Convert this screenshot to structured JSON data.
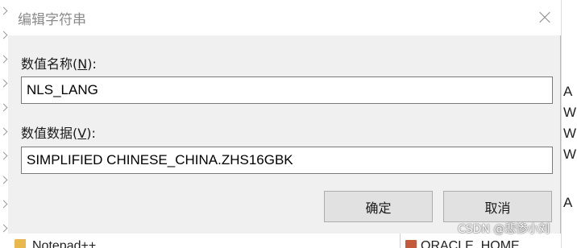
{
  "dialog": {
    "title": "编辑字符串",
    "close_icon": "close-icon",
    "value_name_label_prefix": "数值名称(",
    "value_name_label_key": "N",
    "value_name_label_suffix": "):",
    "value_name": "NLS_LANG",
    "value_data_label_prefix": "数值数据(",
    "value_data_label_key": "V",
    "value_data_label_suffix": "):",
    "value_data": "SIMPLIFIED CHINESE_CHINA.ZHS16GBK",
    "ok_label": "确定",
    "cancel_label": "取消"
  },
  "background": {
    "right_truncated": [
      "A",
      "W",
      "W",
      "W",
      "A"
    ],
    "bottom_left_item": "Notepad++",
    "bottom_right_item": "ORACLE_HOME"
  },
  "watermark": "CSDN @悲惨小刘"
}
